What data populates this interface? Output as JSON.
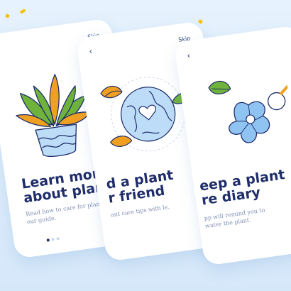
{
  "screens": [
    {
      "skip": "Skip",
      "title_line1": "Learn more",
      "title_line2": "about plants",
      "desc": "Read how to care for plants in our guide.",
      "next": "›",
      "dots": [
        true,
        false,
        false
      ]
    },
    {
      "back": "‹",
      "skip": "Skip",
      "title_line1": "d a plant",
      "title_line2": "r friend",
      "desc": "ant care tips with le.",
      "next": "›"
    },
    {
      "back": "‹",
      "title_line1": "eep a plant",
      "title_line2": "re diary",
      "desc": "pp will remind you to water the plant.",
      "next": "›"
    }
  ],
  "colors": {
    "accent": "#f59a1b",
    "navy": "#1f2d6a",
    "muted": "#7f8fb3",
    "leaf_green": "#6fb33c",
    "leaf_orange": "#f0a020",
    "sky": "#8ec3f2"
  },
  "icons": {
    "plant": "potted-plant-icon",
    "globe": "heart-globe-icon",
    "flower": "blue-flower-icon",
    "magnifier": "magnifier-icon"
  }
}
